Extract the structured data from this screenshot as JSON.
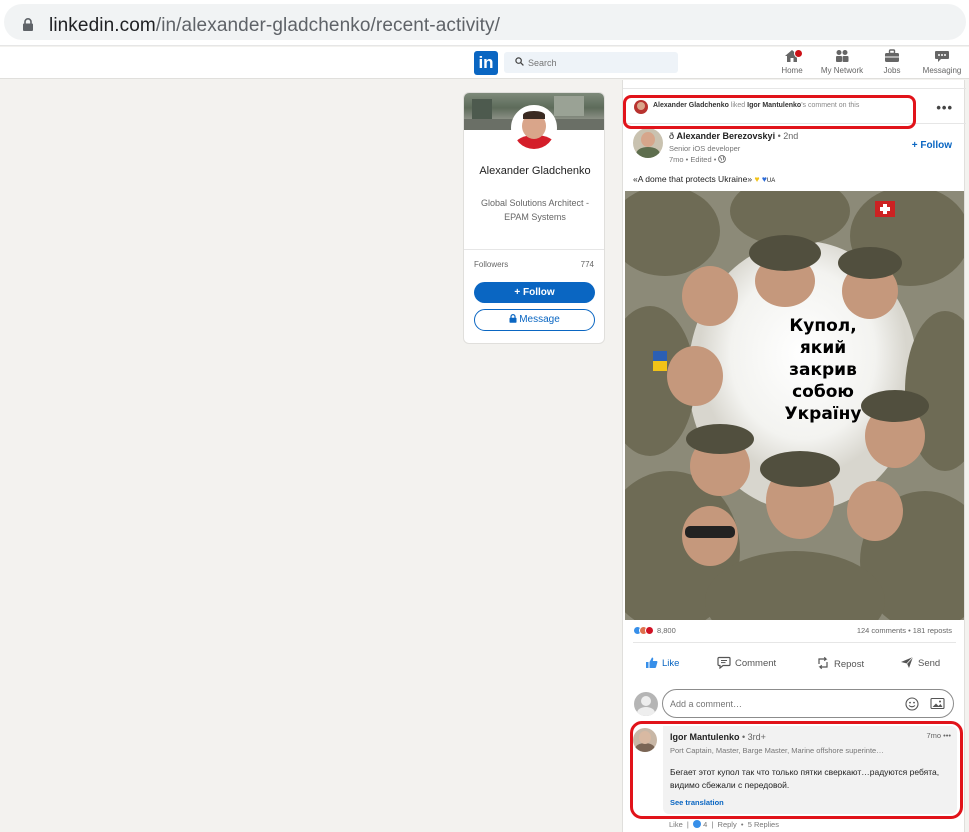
{
  "browser": {
    "url_host": "linkedin.com",
    "url_path": "/in/alexander-gladchenko/recent-activity/"
  },
  "nav": {
    "search_placeholder": "Search",
    "items": [
      {
        "label": "Home",
        "icon": "home-icon"
      },
      {
        "label": "My Network",
        "icon": "network-icon"
      },
      {
        "label": "Jobs",
        "icon": "briefcase-icon"
      },
      {
        "label": "Messaging",
        "icon": "messaging-icon"
      }
    ],
    "logo_text": "in"
  },
  "profile": {
    "name": "Alexander Gladchenko",
    "headline": "Global Solutions Architect - EPAM Systems",
    "followers_label": "Followers",
    "followers_count": "774",
    "follow_label": "+ Follow",
    "message_label": "Message"
  },
  "activity": {
    "actor": "Alexander Gladchenko",
    "verb": " liked ",
    "target": "Igor Mantulenko",
    "suffix": "'s comment on this",
    "more": "•••"
  },
  "post": {
    "author_prefix": "ð ",
    "author_name": "Alexander Berezovskyi",
    "author_degree": " • 2nd",
    "author_title": "Senior iOS developer",
    "time": "7mo • Edited • ",
    "follow_label": "+ Follow",
    "text": "«A dome that protects Ukraine» ",
    "text_flag": "UA",
    "image_caption": [
      "Купол,",
      "який",
      "закрив",
      "собою",
      "Україну"
    ],
    "reaction_count": "8,800",
    "comments_reposts": "124 comments • 181 reposts",
    "actions": [
      "Like",
      "Comment",
      "Repost",
      "Send"
    ]
  },
  "comment_input": {
    "placeholder": "Add a comment…"
  },
  "comment": {
    "name": "Igor Mantulenko",
    "degree": " • 3rd+",
    "time": "7mo •••",
    "title": "Port Captain, Master, Barge Master, Marine offshore superinte…",
    "text": "Бегает этот купол так что только пятки сверкают…радуются ребята, видимо сбежали с передовой.",
    "see_translation": "See translation",
    "like_label": "Like",
    "like_count": "4",
    "reply_label": "Reply",
    "replies": "5 Replies"
  },
  "colors": {
    "linkedin_blue": "#0a66c2",
    "highlight_red": "#e1131a",
    "page_bg": "#f3f2ef"
  }
}
